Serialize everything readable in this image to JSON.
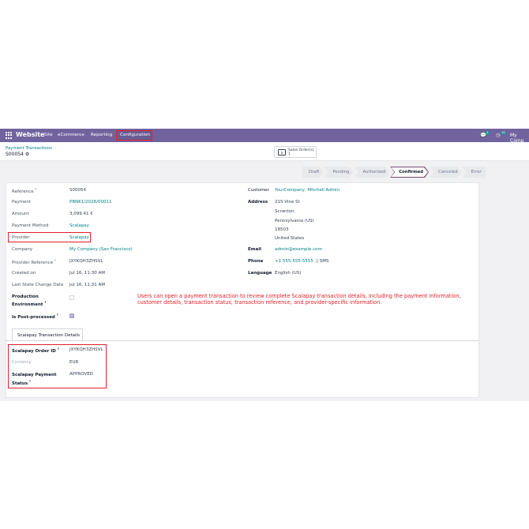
{
  "navbar": {
    "app_name": "Website",
    "menu": [
      "Site",
      "eCommerce",
      "Reporting",
      "Configuration"
    ],
    "company": "My Comp",
    "chat_badge": "4",
    "activity_badge": "30",
    "bg_color": "#71639e"
  },
  "breadcrumb": {
    "parent": "Payment Transactions",
    "current": "S00054"
  },
  "smart_button": {
    "label": "Sales Order(s)",
    "count": "1"
  },
  "statusbar": {
    "stages": [
      "Draft",
      "Pending",
      "Authorized",
      "Confirmed",
      "Canceled",
      "Error"
    ],
    "active": "Confirmed"
  },
  "left_fields": [
    {
      "label": "Reference",
      "help": "?",
      "value": "S00054"
    },
    {
      "label": "Payment",
      "value": "PBNK1/2026/00011"
    },
    {
      "label": "Amount",
      "value": "3,099.41 €"
    },
    {
      "label": "Payment Method",
      "value": "Scalapay"
    },
    {
      "label": "Provider",
      "value": "Scalapay"
    },
    {
      "label": "Company",
      "value": "My Company (San Francisco)"
    },
    {
      "label": "Provider Reference",
      "help": "?",
      "value": "JXYKQH3ZHSVL"
    },
    {
      "label": "Created on",
      "value": "Jul 16, 11:30 AM"
    },
    {
      "label": "Last State Change Date",
      "value": "Jul 16, 11:31 AM"
    },
    {
      "label": "Production Environment",
      "help": "?"
    },
    {
      "label": "Is Post-processed",
      "help": "?"
    }
  ],
  "right_fields": {
    "customer_label": "Customer",
    "customer": "YourCompany, Mitchell Admin",
    "address_label": "Address",
    "address": [
      "215 Vine St",
      "Scranton",
      "Pennsylvania (US)",
      "18503",
      "United States"
    ],
    "email_label": "Email",
    "email": "admin@example.com",
    "phone_label": "Phone",
    "phone": "+1 555-555-5555",
    "sms": "SMS",
    "language_label": "Language",
    "language": "English (US)"
  },
  "annotation": "Users can open a payment transaction to review complete Scalapay transaction details, including the payment information, customer details, transaction status, transaction reference, and provider-specific information.",
  "tab": {
    "label": "Scalapay Transaction Details"
  },
  "scalapay": [
    {
      "label": "Scalapay Order ID",
      "help": "?",
      "value": "JXYKQH3ZHSVL"
    },
    {
      "label": "Currency",
      "value": "EUR"
    },
    {
      "label": "Scalapay Payment Status",
      "help": "?",
      "value": "APPROVED"
    }
  ]
}
